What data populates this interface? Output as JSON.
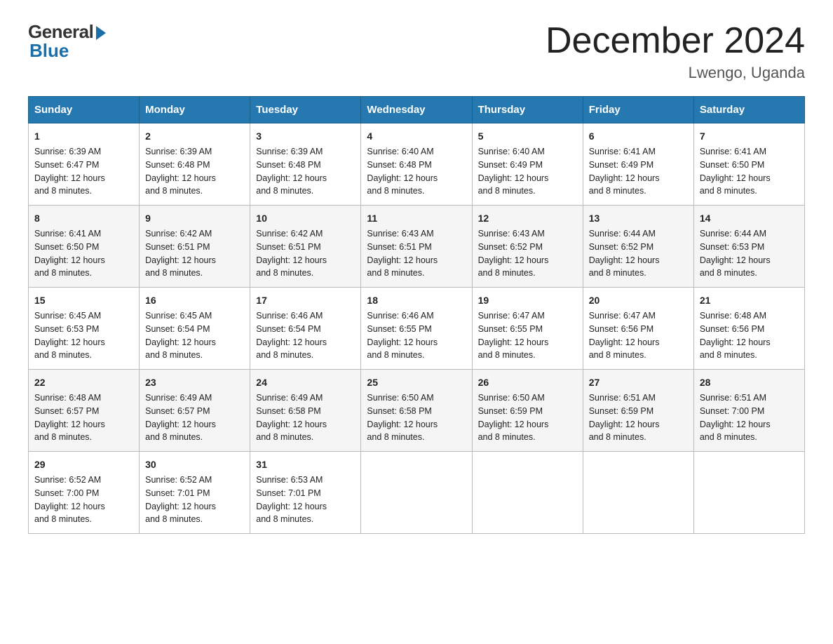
{
  "header": {
    "logo_general": "General",
    "logo_blue": "Blue",
    "month_title": "December 2024",
    "location": "Lwengo, Uganda"
  },
  "days_of_week": [
    "Sunday",
    "Monday",
    "Tuesday",
    "Wednesday",
    "Thursday",
    "Friday",
    "Saturday"
  ],
  "weeks": [
    [
      {
        "day": "1",
        "sunrise": "6:39 AM",
        "sunset": "6:47 PM",
        "daylight": "12 hours and 8 minutes."
      },
      {
        "day": "2",
        "sunrise": "6:39 AM",
        "sunset": "6:48 PM",
        "daylight": "12 hours and 8 minutes."
      },
      {
        "day": "3",
        "sunrise": "6:39 AM",
        "sunset": "6:48 PM",
        "daylight": "12 hours and 8 minutes."
      },
      {
        "day": "4",
        "sunrise": "6:40 AM",
        "sunset": "6:48 PM",
        "daylight": "12 hours and 8 minutes."
      },
      {
        "day": "5",
        "sunrise": "6:40 AM",
        "sunset": "6:49 PM",
        "daylight": "12 hours and 8 minutes."
      },
      {
        "day": "6",
        "sunrise": "6:41 AM",
        "sunset": "6:49 PM",
        "daylight": "12 hours and 8 minutes."
      },
      {
        "day": "7",
        "sunrise": "6:41 AM",
        "sunset": "6:50 PM",
        "daylight": "12 hours and 8 minutes."
      }
    ],
    [
      {
        "day": "8",
        "sunrise": "6:41 AM",
        "sunset": "6:50 PM",
        "daylight": "12 hours and 8 minutes."
      },
      {
        "day": "9",
        "sunrise": "6:42 AM",
        "sunset": "6:51 PM",
        "daylight": "12 hours and 8 minutes."
      },
      {
        "day": "10",
        "sunrise": "6:42 AM",
        "sunset": "6:51 PM",
        "daylight": "12 hours and 8 minutes."
      },
      {
        "day": "11",
        "sunrise": "6:43 AM",
        "sunset": "6:51 PM",
        "daylight": "12 hours and 8 minutes."
      },
      {
        "day": "12",
        "sunrise": "6:43 AM",
        "sunset": "6:52 PM",
        "daylight": "12 hours and 8 minutes."
      },
      {
        "day": "13",
        "sunrise": "6:44 AM",
        "sunset": "6:52 PM",
        "daylight": "12 hours and 8 minutes."
      },
      {
        "day": "14",
        "sunrise": "6:44 AM",
        "sunset": "6:53 PM",
        "daylight": "12 hours and 8 minutes."
      }
    ],
    [
      {
        "day": "15",
        "sunrise": "6:45 AM",
        "sunset": "6:53 PM",
        "daylight": "12 hours and 8 minutes."
      },
      {
        "day": "16",
        "sunrise": "6:45 AM",
        "sunset": "6:54 PM",
        "daylight": "12 hours and 8 minutes."
      },
      {
        "day": "17",
        "sunrise": "6:46 AM",
        "sunset": "6:54 PM",
        "daylight": "12 hours and 8 minutes."
      },
      {
        "day": "18",
        "sunrise": "6:46 AM",
        "sunset": "6:55 PM",
        "daylight": "12 hours and 8 minutes."
      },
      {
        "day": "19",
        "sunrise": "6:47 AM",
        "sunset": "6:55 PM",
        "daylight": "12 hours and 8 minutes."
      },
      {
        "day": "20",
        "sunrise": "6:47 AM",
        "sunset": "6:56 PM",
        "daylight": "12 hours and 8 minutes."
      },
      {
        "day": "21",
        "sunrise": "6:48 AM",
        "sunset": "6:56 PM",
        "daylight": "12 hours and 8 minutes."
      }
    ],
    [
      {
        "day": "22",
        "sunrise": "6:48 AM",
        "sunset": "6:57 PM",
        "daylight": "12 hours and 8 minutes."
      },
      {
        "day": "23",
        "sunrise": "6:49 AM",
        "sunset": "6:57 PM",
        "daylight": "12 hours and 8 minutes."
      },
      {
        "day": "24",
        "sunrise": "6:49 AM",
        "sunset": "6:58 PM",
        "daylight": "12 hours and 8 minutes."
      },
      {
        "day": "25",
        "sunrise": "6:50 AM",
        "sunset": "6:58 PM",
        "daylight": "12 hours and 8 minutes."
      },
      {
        "day": "26",
        "sunrise": "6:50 AM",
        "sunset": "6:59 PM",
        "daylight": "12 hours and 8 minutes."
      },
      {
        "day": "27",
        "sunrise": "6:51 AM",
        "sunset": "6:59 PM",
        "daylight": "12 hours and 8 minutes."
      },
      {
        "day": "28",
        "sunrise": "6:51 AM",
        "sunset": "7:00 PM",
        "daylight": "12 hours and 8 minutes."
      }
    ],
    [
      {
        "day": "29",
        "sunrise": "6:52 AM",
        "sunset": "7:00 PM",
        "daylight": "12 hours and 8 minutes."
      },
      {
        "day": "30",
        "sunrise": "6:52 AM",
        "sunset": "7:01 PM",
        "daylight": "12 hours and 8 minutes."
      },
      {
        "day": "31",
        "sunrise": "6:53 AM",
        "sunset": "7:01 PM",
        "daylight": "12 hours and 8 minutes."
      },
      null,
      null,
      null,
      null
    ]
  ],
  "labels": {
    "sunrise": "Sunrise:",
    "sunset": "Sunset:",
    "daylight": "Daylight:"
  }
}
